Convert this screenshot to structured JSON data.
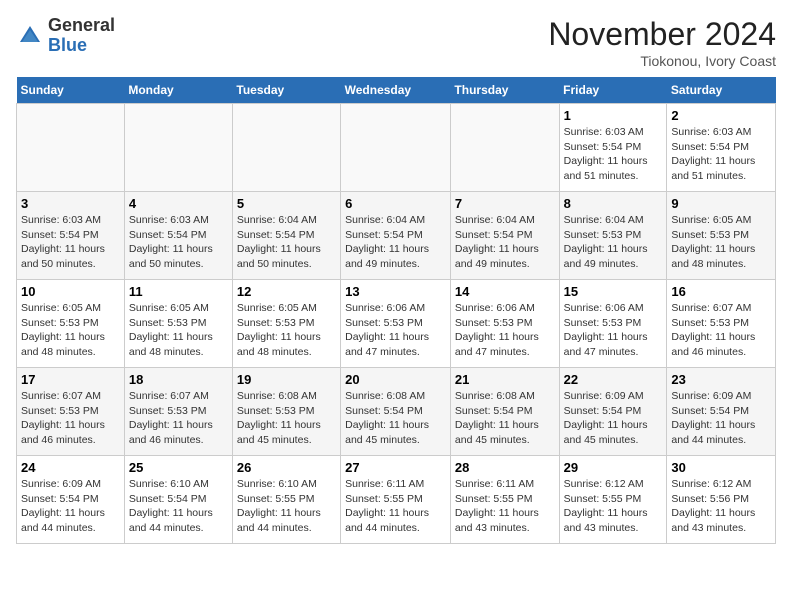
{
  "header": {
    "logo_line1": "General",
    "logo_line2": "Blue",
    "month": "November 2024",
    "location": "Tiokonou, Ivory Coast"
  },
  "weekdays": [
    "Sunday",
    "Monday",
    "Tuesday",
    "Wednesday",
    "Thursday",
    "Friday",
    "Saturday"
  ],
  "weeks": [
    [
      {
        "day": "",
        "info": ""
      },
      {
        "day": "",
        "info": ""
      },
      {
        "day": "",
        "info": ""
      },
      {
        "day": "",
        "info": ""
      },
      {
        "day": "",
        "info": ""
      },
      {
        "day": "1",
        "info": "Sunrise: 6:03 AM\nSunset: 5:54 PM\nDaylight: 11 hours and 51 minutes."
      },
      {
        "day": "2",
        "info": "Sunrise: 6:03 AM\nSunset: 5:54 PM\nDaylight: 11 hours and 51 minutes."
      }
    ],
    [
      {
        "day": "3",
        "info": "Sunrise: 6:03 AM\nSunset: 5:54 PM\nDaylight: 11 hours and 50 minutes."
      },
      {
        "day": "4",
        "info": "Sunrise: 6:03 AM\nSunset: 5:54 PM\nDaylight: 11 hours and 50 minutes."
      },
      {
        "day": "5",
        "info": "Sunrise: 6:04 AM\nSunset: 5:54 PM\nDaylight: 11 hours and 50 minutes."
      },
      {
        "day": "6",
        "info": "Sunrise: 6:04 AM\nSunset: 5:54 PM\nDaylight: 11 hours and 49 minutes."
      },
      {
        "day": "7",
        "info": "Sunrise: 6:04 AM\nSunset: 5:54 PM\nDaylight: 11 hours and 49 minutes."
      },
      {
        "day": "8",
        "info": "Sunrise: 6:04 AM\nSunset: 5:53 PM\nDaylight: 11 hours and 49 minutes."
      },
      {
        "day": "9",
        "info": "Sunrise: 6:05 AM\nSunset: 5:53 PM\nDaylight: 11 hours and 48 minutes."
      }
    ],
    [
      {
        "day": "10",
        "info": "Sunrise: 6:05 AM\nSunset: 5:53 PM\nDaylight: 11 hours and 48 minutes."
      },
      {
        "day": "11",
        "info": "Sunrise: 6:05 AM\nSunset: 5:53 PM\nDaylight: 11 hours and 48 minutes."
      },
      {
        "day": "12",
        "info": "Sunrise: 6:05 AM\nSunset: 5:53 PM\nDaylight: 11 hours and 48 minutes."
      },
      {
        "day": "13",
        "info": "Sunrise: 6:06 AM\nSunset: 5:53 PM\nDaylight: 11 hours and 47 minutes."
      },
      {
        "day": "14",
        "info": "Sunrise: 6:06 AM\nSunset: 5:53 PM\nDaylight: 11 hours and 47 minutes."
      },
      {
        "day": "15",
        "info": "Sunrise: 6:06 AM\nSunset: 5:53 PM\nDaylight: 11 hours and 47 minutes."
      },
      {
        "day": "16",
        "info": "Sunrise: 6:07 AM\nSunset: 5:53 PM\nDaylight: 11 hours and 46 minutes."
      }
    ],
    [
      {
        "day": "17",
        "info": "Sunrise: 6:07 AM\nSunset: 5:53 PM\nDaylight: 11 hours and 46 minutes."
      },
      {
        "day": "18",
        "info": "Sunrise: 6:07 AM\nSunset: 5:53 PM\nDaylight: 11 hours and 46 minutes."
      },
      {
        "day": "19",
        "info": "Sunrise: 6:08 AM\nSunset: 5:53 PM\nDaylight: 11 hours and 45 minutes."
      },
      {
        "day": "20",
        "info": "Sunrise: 6:08 AM\nSunset: 5:54 PM\nDaylight: 11 hours and 45 minutes."
      },
      {
        "day": "21",
        "info": "Sunrise: 6:08 AM\nSunset: 5:54 PM\nDaylight: 11 hours and 45 minutes."
      },
      {
        "day": "22",
        "info": "Sunrise: 6:09 AM\nSunset: 5:54 PM\nDaylight: 11 hours and 45 minutes."
      },
      {
        "day": "23",
        "info": "Sunrise: 6:09 AM\nSunset: 5:54 PM\nDaylight: 11 hours and 44 minutes."
      }
    ],
    [
      {
        "day": "24",
        "info": "Sunrise: 6:09 AM\nSunset: 5:54 PM\nDaylight: 11 hours and 44 minutes."
      },
      {
        "day": "25",
        "info": "Sunrise: 6:10 AM\nSunset: 5:54 PM\nDaylight: 11 hours and 44 minutes."
      },
      {
        "day": "26",
        "info": "Sunrise: 6:10 AM\nSunset: 5:55 PM\nDaylight: 11 hours and 44 minutes."
      },
      {
        "day": "27",
        "info": "Sunrise: 6:11 AM\nSunset: 5:55 PM\nDaylight: 11 hours and 44 minutes."
      },
      {
        "day": "28",
        "info": "Sunrise: 6:11 AM\nSunset: 5:55 PM\nDaylight: 11 hours and 43 minutes."
      },
      {
        "day": "29",
        "info": "Sunrise: 6:12 AM\nSunset: 5:55 PM\nDaylight: 11 hours and 43 minutes."
      },
      {
        "day": "30",
        "info": "Sunrise: 6:12 AM\nSunset: 5:56 PM\nDaylight: 11 hours and 43 minutes."
      }
    ]
  ]
}
